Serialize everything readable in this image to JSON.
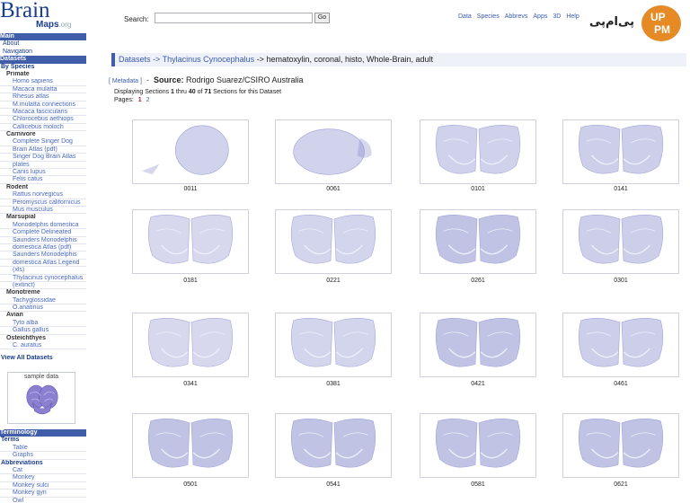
{
  "logo": {
    "brain": "Brain",
    "maps": "Maps",
    "org": ".org"
  },
  "sidebar": {
    "rows": [
      {
        "t": "Main",
        "k": "h"
      },
      {
        "t": "About",
        "k": "l1"
      },
      {
        "t": "Navigation",
        "k": "l1"
      },
      {
        "t": "Datasets",
        "k": "h"
      },
      {
        "t": "By Species",
        "k": "l1b"
      },
      {
        "t": "Primate",
        "k": "cat"
      },
      {
        "t": "Homo sapiens",
        "k": "sp"
      },
      {
        "t": "Macaca mulatta",
        "k": "sp"
      },
      {
        "t": "Rhesus atlas",
        "k": "sp"
      },
      {
        "t": "M.mulatta connections",
        "k": "sp"
      },
      {
        "t": "Macaca fascicularis",
        "k": "sp"
      },
      {
        "t": "Chlorocebus aethiops",
        "k": "sp"
      },
      {
        "t": "Callicebus moloch",
        "k": "sp"
      },
      {
        "t": "Carnivore",
        "k": "cat"
      },
      {
        "t": "Complete Singer Dog",
        "k": "sp"
      },
      {
        "t": "Brain Atlas (pdf)",
        "k": "sp"
      },
      {
        "t": "Singer Dog Brain Atlas",
        "k": "sp"
      },
      {
        "t": "plates",
        "k": "sp"
      },
      {
        "t": "Canis lupus",
        "k": "sp"
      },
      {
        "t": "Felis catus",
        "k": "sp"
      },
      {
        "t": "Rodent",
        "k": "cat"
      },
      {
        "t": "Rattus norvegicus",
        "k": "sp"
      },
      {
        "t": "Peromyscus californicus",
        "k": "sp"
      },
      {
        "t": "Mus musculus",
        "k": "sp"
      },
      {
        "t": "Marsupial",
        "k": "cat"
      },
      {
        "t": "Monodelphis domestica",
        "k": "sp"
      },
      {
        "t": "Complete Delineated",
        "k": "sp"
      },
      {
        "t": "Saunders Monodelphis",
        "k": "sp"
      },
      {
        "t": "domestica Atlas (pdf)",
        "k": "sp"
      },
      {
        "t": "Saunders Monodelphis",
        "k": "sp"
      },
      {
        "t": "domestica Atlas Legend",
        "k": "sp"
      },
      {
        "t": "(xls)",
        "k": "sp"
      },
      {
        "t": "Thylacinus cynocephalus",
        "k": "sp"
      },
      {
        "t": "(extinct)",
        "k": "sp"
      },
      {
        "t": "Monotreme",
        "k": "cat"
      },
      {
        "t": "Tachyglossidae",
        "k": "sp"
      },
      {
        "t": "O.anatinus",
        "k": "sp"
      },
      {
        "t": "Avian",
        "k": "cat"
      },
      {
        "t": "Tyto alba",
        "k": "sp"
      },
      {
        "t": "Gallus gallus",
        "k": "sp"
      },
      {
        "t": "Osteichthyes",
        "k": "cat"
      },
      {
        "t": "C. auratus",
        "k": "sp"
      },
      {
        "t": "",
        "k": "gap"
      },
      {
        "t": "View All Datasets",
        "k": "l1b"
      }
    ],
    "sample_label": "sample data",
    "rows2": [
      {
        "t": "Terminology",
        "k": "h"
      },
      {
        "t": "Terms",
        "k": "l1b"
      },
      {
        "t": "Table",
        "k": "sp"
      },
      {
        "t": "Graphs",
        "k": "sp"
      },
      {
        "t": "Abbreviations",
        "k": "l1b"
      },
      {
        "t": "Cat",
        "k": "sp"
      },
      {
        "t": "Monkey",
        "k": "sp"
      },
      {
        "t": "Monkey sulci",
        "k": "sp"
      },
      {
        "t": "Monkey gyri",
        "k": "sp"
      },
      {
        "t": "Owl",
        "k": "sp"
      }
    ]
  },
  "header": {
    "search_label": "Search:",
    "search_value": "",
    "go_label": "Go",
    "nav": [
      "Data",
      "Species",
      "Abbrevs",
      "Apps",
      "3D",
      "Help"
    ]
  },
  "watermark": {
    "text": "پی‌ام‌پی",
    "up": "UP",
    "pm": "PM"
  },
  "main": {
    "breadcrumb": {
      "datasets": "Datasets",
      "arrow1": " -> ",
      "species": "Thylacinus Cynocephalus",
      "rest": " -> hematoxylin, coronal, histo, Whole-Brain, adult"
    },
    "metadata_link": "[ Metadata ]",
    "sep": "-",
    "source_label": "Source:",
    "source_value": "Rodrigo Suarez/CSIRO Australia",
    "displaying": {
      "pre": "Displaying Sections ",
      "from": "1",
      "mid": " thru ",
      "to": "40",
      "of": " of ",
      "total": "71",
      "post": " Sections for this Dataset"
    },
    "pages_label": "Pages:",
    "pages": [
      "1",
      "2"
    ],
    "thumbs": [
      "0011",
      "0061",
      "0101",
      "0141",
      "0181",
      "0221",
      "0261",
      "0301",
      "0341",
      "0381",
      "0421",
      "0461",
      "0501",
      "0541",
      "0581",
      "0621"
    ]
  },
  "colors": {
    "accent": "#3f5da8",
    "link": "#3a5bb0",
    "stain": "#7a7fc8"
  }
}
